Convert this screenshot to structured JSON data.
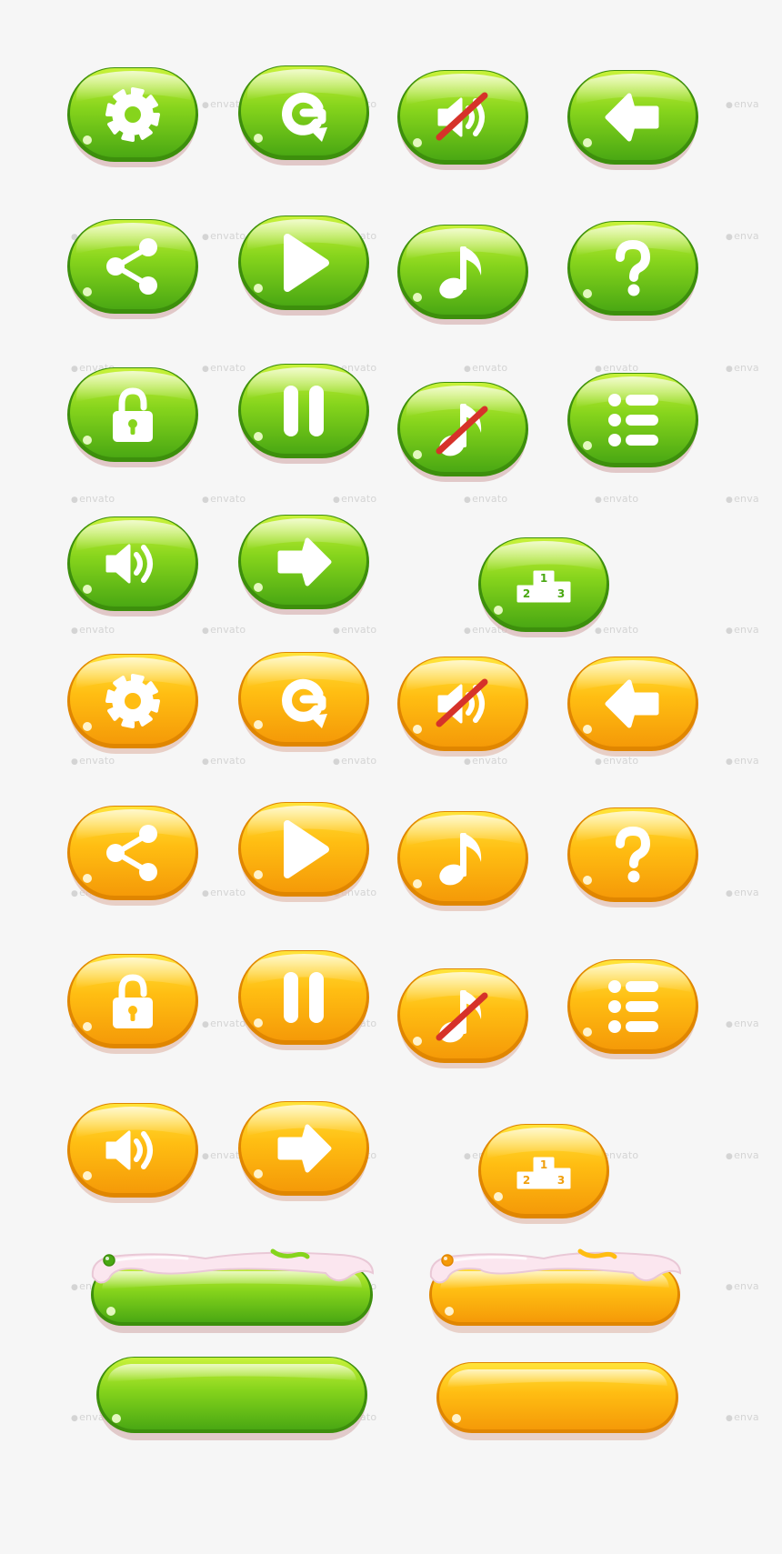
{
  "page": {
    "background": "#f6f6f6"
  },
  "themes": {
    "green": {
      "top": "#c9f23a",
      "mid": "#86d41c",
      "bottom": "#4aa813",
      "rim": "#3d8f0c",
      "shadow": "#d9b8b8",
      "highlight": "#f2ffd0",
      "icon_text": "#4aa813"
    },
    "orange": {
      "top": "#ffe43a",
      "mid": "#ffbd12",
      "bottom": "#f59a08",
      "rim": "#e08600",
      "shadow": "#e3c2b6",
      "highlight": "#fffbe0",
      "icon_text": "#f0a010"
    }
  },
  "slash_color": "#d6322a",
  "icon_color": "#ffffff",
  "green_buttons": [
    {
      "icon": "gear-icon",
      "name": "settings-button-green"
    },
    {
      "icon": "restart-icon",
      "name": "restart-button-green"
    },
    {
      "icon": "sound-off-icon",
      "name": "sound-off-button-green"
    },
    {
      "icon": "arrow-left-icon",
      "name": "back-button-green"
    },
    {
      "icon": "share-icon",
      "name": "share-button-green"
    },
    {
      "icon": "play-icon",
      "name": "play-button-green"
    },
    {
      "icon": "music-note-icon",
      "name": "music-button-green"
    },
    {
      "icon": "question-mark-icon",
      "name": "help-button-green"
    },
    {
      "icon": "padlock-icon",
      "name": "lock-button-green"
    },
    {
      "icon": "pause-icon",
      "name": "pause-button-green"
    },
    {
      "icon": "music-off-icon",
      "name": "music-off-button-green"
    },
    {
      "icon": "list-menu-icon",
      "name": "menu-button-green"
    },
    {
      "icon": "speaker-icon",
      "name": "sound-on-button-green"
    },
    {
      "icon": "arrow-right-icon",
      "name": "next-button-green"
    },
    {
      "icon": "podium-icon",
      "name": "leaderboard-button-green"
    }
  ],
  "orange_buttons": [
    {
      "icon": "gear-icon",
      "name": "settings-button-orange"
    },
    {
      "icon": "restart-icon",
      "name": "restart-button-orange"
    },
    {
      "icon": "sound-off-icon",
      "name": "sound-off-button-orange"
    },
    {
      "icon": "arrow-left-icon",
      "name": "back-button-orange"
    },
    {
      "icon": "share-icon",
      "name": "share-button-orange"
    },
    {
      "icon": "play-icon",
      "name": "play-button-orange"
    },
    {
      "icon": "music-note-icon",
      "name": "music-button-orange"
    },
    {
      "icon": "question-mark-icon",
      "name": "help-button-orange"
    },
    {
      "icon": "padlock-icon",
      "name": "lock-button-orange"
    },
    {
      "icon": "pause-icon",
      "name": "pause-button-orange"
    },
    {
      "icon": "music-off-icon",
      "name": "music-off-button-orange"
    },
    {
      "icon": "list-menu-icon",
      "name": "menu-button-orange"
    },
    {
      "icon": "speaker-icon",
      "name": "sound-on-button-orange"
    },
    {
      "icon": "arrow-right-icon",
      "name": "next-button-orange"
    },
    {
      "icon": "podium-icon",
      "name": "leaderboard-button-orange"
    }
  ],
  "podium_labels": [
    "1",
    "2",
    "3"
  ],
  "wide_buttons": [
    {
      "name": "wide-button-green-frosted",
      "theme": "green",
      "frosting": true,
      "frosting_color": "#fbe6ef"
    },
    {
      "name": "wide-button-orange-frosted",
      "theme": "orange",
      "frosting": true,
      "frosting_color": "#fbe6ef"
    },
    {
      "name": "wide-button-green",
      "theme": "green",
      "frosting": false
    },
    {
      "name": "wide-button-orange",
      "theme": "orange",
      "frosting": false
    }
  ],
  "watermark": {
    "text": "envato",
    "truncated_text": "enva",
    "color": "#d4d4d4"
  }
}
